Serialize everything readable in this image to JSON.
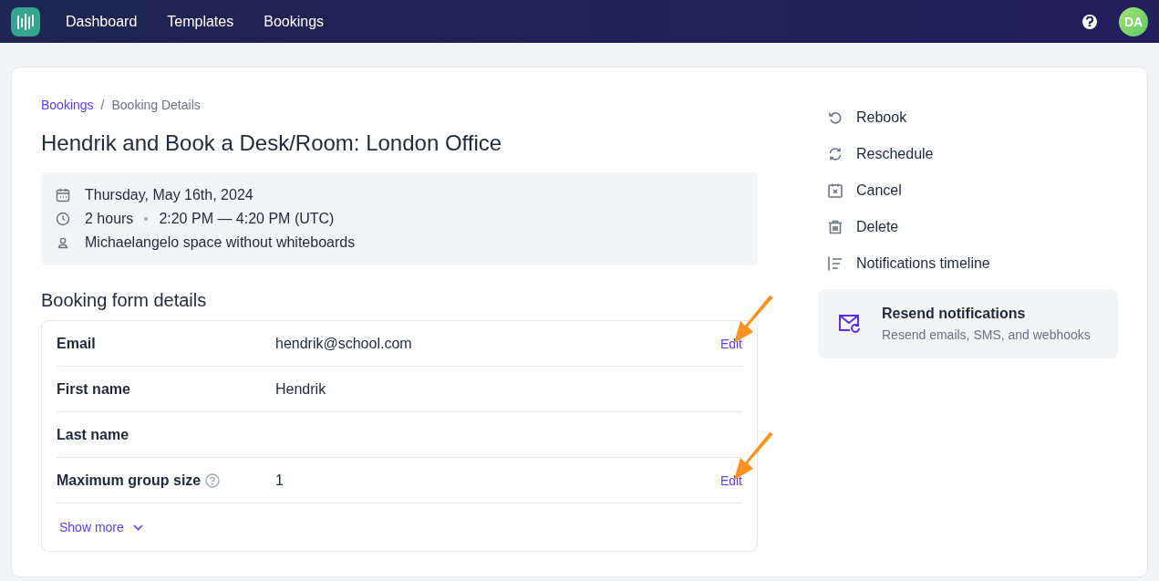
{
  "nav": {
    "items": [
      {
        "label": "Dashboard"
      },
      {
        "label": "Templates"
      },
      {
        "label": "Bookings"
      }
    ],
    "avatar": "DA"
  },
  "breadcrumb": [
    {
      "label": "Bookings",
      "link": true
    },
    {
      "label": "Booking Details",
      "link": false
    }
  ],
  "breadcrumb_separator": "/",
  "title": "Hendrik and Book a Desk/Room: London Office",
  "summary": {
    "date": "Thursday, May 16th, 2024",
    "duration": "2 hours",
    "time": "2:20 PM — 4:20 PM (UTC)",
    "resource": "Michaelangelo space without whiteboards"
  },
  "form": {
    "heading": "Booking form details",
    "rows": [
      {
        "label": "Email",
        "value": "hendrik@school.com",
        "help": false,
        "edit": "Edit",
        "arrow": true
      },
      {
        "label": "First name",
        "value": "Hendrik",
        "help": false,
        "arrow": false
      },
      {
        "label": "Last name",
        "help": false,
        "arrow": false
      },
      {
        "label": "Maximum group size",
        "value": "1",
        "help": true,
        "edit": "Edit",
        "arrow": true
      }
    ],
    "show_more": "Show more"
  },
  "actions": [
    {
      "label": "Rebook"
    },
    {
      "label": "Reschedule"
    },
    {
      "label": "Cancel"
    },
    {
      "label": "Delete"
    },
    {
      "label": "Notifications timeline"
    }
  ],
  "resend": {
    "title": "Resend notifications",
    "subtitle": "Resend emails, SMS, and webhooks"
  }
}
